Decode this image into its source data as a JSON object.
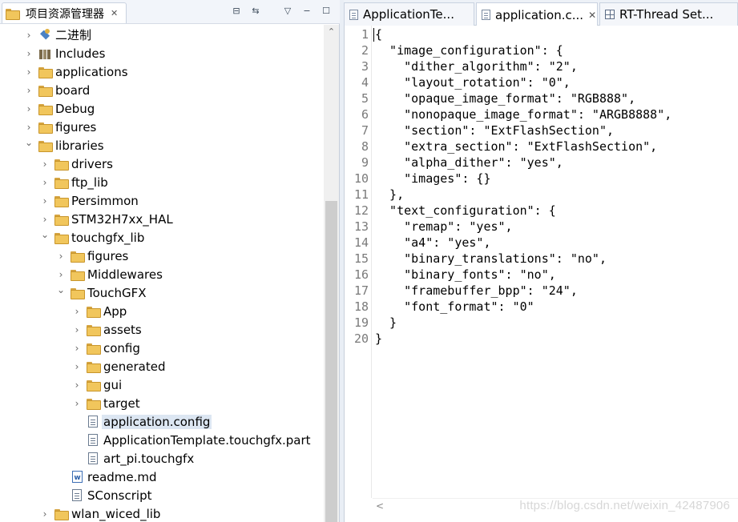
{
  "explorer": {
    "title": "项目资源管理器",
    "tree": [
      {
        "label": "二进制",
        "icon": "binary-icon",
        "kind": "binary",
        "depth": 0,
        "expanded": false
      },
      {
        "label": "Includes",
        "icon": "library-icon",
        "kind": "lib",
        "depth": 0,
        "expanded": false
      },
      {
        "label": "applications",
        "icon": "folder-icon",
        "kind": "folder",
        "depth": 0,
        "expanded": false
      },
      {
        "label": "board",
        "icon": "folder-icon",
        "kind": "folder",
        "depth": 0,
        "expanded": false
      },
      {
        "label": "Debug",
        "icon": "folder-icon",
        "kind": "folder",
        "depth": 0,
        "expanded": false
      },
      {
        "label": "figures",
        "icon": "folder-icon",
        "kind": "folder",
        "depth": 0,
        "expanded": false
      },
      {
        "label": "libraries",
        "icon": "folder-icon",
        "kind": "folder",
        "depth": 0,
        "expanded": true
      },
      {
        "label": "drivers",
        "icon": "folder-icon",
        "kind": "folder",
        "depth": 1,
        "expanded": false
      },
      {
        "label": "ftp_lib",
        "icon": "folder-icon",
        "kind": "folder",
        "depth": 1,
        "expanded": false
      },
      {
        "label": "Persimmon",
        "icon": "folder-icon",
        "kind": "folder",
        "depth": 1,
        "expanded": false
      },
      {
        "label": "STM32H7xx_HAL",
        "icon": "folder-icon",
        "kind": "folder",
        "depth": 1,
        "expanded": false
      },
      {
        "label": "touchgfx_lib",
        "icon": "folder-icon",
        "kind": "folder",
        "depth": 1,
        "expanded": true
      },
      {
        "label": "figures",
        "icon": "folder-icon",
        "kind": "folder",
        "depth": 2,
        "expanded": false
      },
      {
        "label": "Middlewares",
        "icon": "folder-icon",
        "kind": "folder",
        "depth": 2,
        "expanded": false
      },
      {
        "label": "TouchGFX",
        "icon": "folder-icon",
        "kind": "folder",
        "depth": 2,
        "expanded": true
      },
      {
        "label": "App",
        "icon": "folder-icon",
        "kind": "folder",
        "depth": 3,
        "expanded": false
      },
      {
        "label": "assets",
        "icon": "folder-icon",
        "kind": "folder",
        "depth": 3,
        "expanded": false
      },
      {
        "label": "config",
        "icon": "folder-icon",
        "kind": "folder",
        "depth": 3,
        "expanded": false
      },
      {
        "label": "generated",
        "icon": "folder-icon",
        "kind": "folder",
        "depth": 3,
        "expanded": false
      },
      {
        "label": "gui",
        "icon": "folder-icon",
        "kind": "folder",
        "depth": 3,
        "expanded": false
      },
      {
        "label": "target",
        "icon": "folder-icon",
        "kind": "folder",
        "depth": 3,
        "expanded": false
      },
      {
        "label": "application.config",
        "icon": "file-icon",
        "kind": "file",
        "depth": 3,
        "selected": true
      },
      {
        "label": "ApplicationTemplate.touchgfx.part",
        "icon": "file-icon",
        "kind": "file",
        "depth": 3
      },
      {
        "label": "art_pi.touchgfx",
        "icon": "file-icon",
        "kind": "file",
        "depth": 3
      },
      {
        "label": "readme.md",
        "icon": "word-icon",
        "kind": "word",
        "depth": 2
      },
      {
        "label": "SConscript",
        "icon": "file-icon",
        "kind": "file",
        "depth": 2
      },
      {
        "label": "wlan_wiced_lib",
        "icon": "folder-icon",
        "kind": "folder",
        "depth": 1,
        "expanded": false
      }
    ]
  },
  "editor": {
    "tabs": [
      {
        "label": "ApplicationTe...",
        "icon": "document-icon",
        "active": false
      },
      {
        "label": "application.c...",
        "icon": "document-icon",
        "active": true
      },
      {
        "label": "RT-Thread Set...",
        "icon": "settings-grid-icon",
        "active": false
      }
    ],
    "lines": [
      "{",
      "  \"image_configuration\": {",
      "    \"dither_algorithm\": \"2\",",
      "    \"layout_rotation\": \"0\",",
      "    \"opaque_image_format\": \"RGB888\",",
      "    \"nonopaque_image_format\": \"ARGB8888\",",
      "    \"section\": \"ExtFlashSection\",",
      "    \"extra_section\": \"ExtFlashSection\",",
      "    \"alpha_dither\": \"yes\",",
      "    \"images\": {}",
      "  },",
      "  \"text_configuration\": {",
      "    \"remap\": \"yes\",",
      "    \"a4\": \"yes\",",
      "    \"binary_translations\": \"no\",",
      "    \"binary_fonts\": \"no\",",
      "    \"framebuffer_bpp\": \"24\",",
      "    \"font_format\": \"0\"",
      "  }",
      "}"
    ],
    "watermark": "https://blog.csdn.net/weixin_42487906"
  }
}
